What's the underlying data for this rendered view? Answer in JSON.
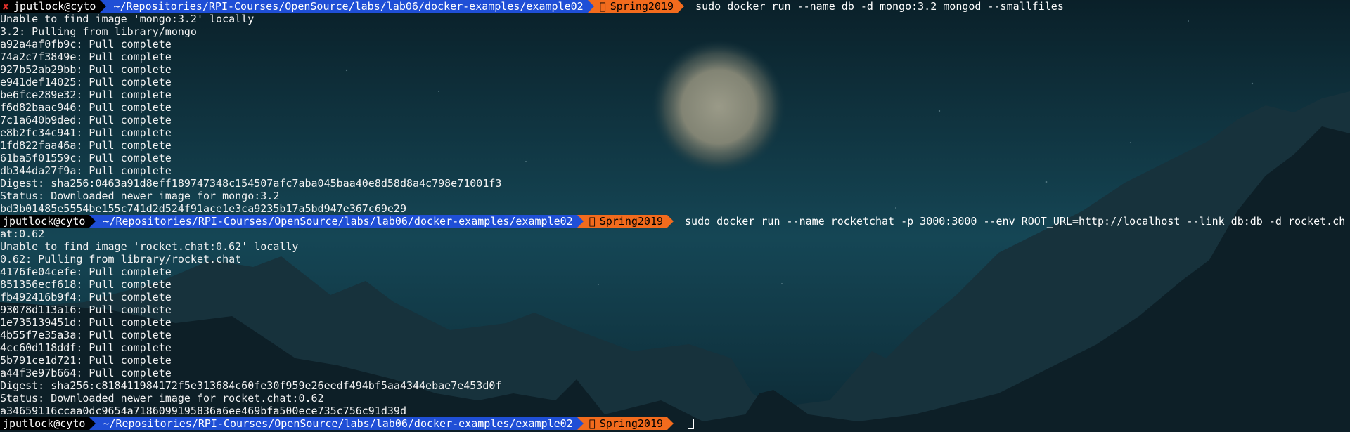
{
  "theme": {
    "user_segment_bg": "#000000",
    "path_segment_bg": "#1f4fd6",
    "branch_segment_bg": "#f26b1d",
    "error_icon_color": "#e0302a",
    "text_color": "#f2f2f2"
  },
  "prompt": {
    "user_host": "jputlock@cyto",
    "path": "~/Repositories/RPI-Courses/OpenSource/labs/lab06/docker-examples/example02",
    "branch_icon": "",
    "branch": "Spring2019",
    "error_icon": "✘"
  },
  "session": {
    "cmd1": {
      "command": "sudo docker run --name db -d mongo:3.2 mongod --smallfiles"
    },
    "out1": [
      "Unable to find image 'mongo:3.2' locally",
      "3.2: Pulling from library/mongo",
      "a92a4af0fb9c: Pull complete",
      "74a2c7f3849e: Pull complete",
      "927b52ab29bb: Pull complete",
      "e941def14025: Pull complete",
      "be6fce289e32: Pull complete",
      "f6d82baac946: Pull complete",
      "7c1a640b9ded: Pull complete",
      "e8b2fc34c941: Pull complete",
      "1fd822faa46a: Pull complete",
      "61ba5f01559c: Pull complete",
      "db344da27f9a: Pull complete",
      "Digest: sha256:0463a91d8eff189747348c154507afc7aba045baa40e8d58d8a4c798e71001f3",
      "Status: Downloaded newer image for mongo:3.2",
      "bd3b01485e5554be155c741d2d524f91ace1e3ca9235b17a5bd947e367c69e29"
    ],
    "cmd2": {
      "command": "sudo docker run --name rocketchat -p 3000:3000 --env ROOT_URL=http://localhost --link db:db -d rocket.ch"
    },
    "out2": [
      "at:0.62",
      "Unable to find image 'rocket.chat:0.62' locally",
      "0.62: Pulling from library/rocket.chat",
      "4176fe04cefe: Pull complete",
      "851356ecf618: Pull complete",
      "fb492416b9f4: Pull complete",
      "93078d113a16: Pull complete",
      "1e735139451d: Pull complete",
      "4b55f7e35a3a: Pull complete",
      "4cc60d118ddf: Pull complete",
      "5b791ce1d721: Pull complete",
      "a44f3e97b664: Pull complete",
      "Digest: sha256:c818411984172f5e313684c60fe30f959e26eedf494bf5aa4344ebae7e453d0f",
      "Status: Downloaded newer image for rocket.chat:0.62",
      "a34659116ccaa0dc9654a7186099195836a6ee469bfa500ece735c756c91d39d"
    ],
    "cmd3": {
      "command": ""
    }
  }
}
